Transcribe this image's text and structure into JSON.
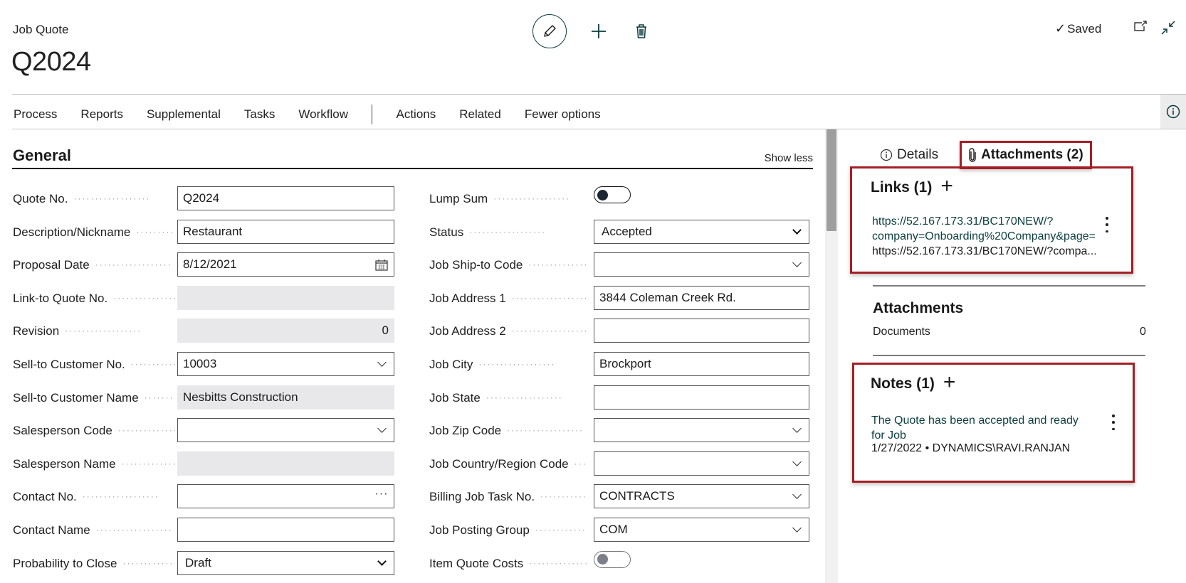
{
  "header": {
    "caption": "Job Quote",
    "title": "Q2024",
    "saved_label": "Saved",
    "icons": {
      "edit": "pencil-icon",
      "new": "plus-icon",
      "delete": "trash-icon",
      "open_new_window": "open-in-new-window-icon",
      "collapse": "collapse-icon"
    }
  },
  "action_bar": {
    "items": [
      "Process",
      "Reports",
      "Supplemental",
      "Tasks",
      "Workflow"
    ],
    "items_after_separator": [
      "Actions",
      "Related",
      "Fewer options"
    ],
    "info_icon": "info-icon"
  },
  "general": {
    "title": "General",
    "show_less": "Show less",
    "left_fields": [
      {
        "label": "Quote No.",
        "value": "Q2024",
        "type": "text"
      },
      {
        "label": "Description/Nickname",
        "value": "Restaurant",
        "type": "text"
      },
      {
        "label": "Proposal Date",
        "value": "8/12/2021",
        "type": "date"
      },
      {
        "label": "Link-to Quote No.",
        "value": "",
        "type": "readonly"
      },
      {
        "label": "Revision",
        "value": "0",
        "type": "readonly-number"
      },
      {
        "label": "Sell-to Customer No.",
        "value": "10003",
        "type": "lookup"
      },
      {
        "label": "Sell-to Customer Name",
        "value": "Nesbitts Construction",
        "type": "readonly"
      },
      {
        "label": "Salesperson Code",
        "value": "",
        "type": "lookup"
      },
      {
        "label": "Salesperson Name",
        "value": "",
        "type": "readonly"
      },
      {
        "label": "Contact No.",
        "value": "",
        "type": "assist"
      },
      {
        "label": "Contact Name",
        "value": "",
        "type": "text"
      },
      {
        "label": "Probability to Close",
        "value": "Draft",
        "type": "select"
      }
    ],
    "right_fields": [
      {
        "label": "Lump Sum",
        "value": "Off",
        "type": "toggle"
      },
      {
        "label": "Status",
        "value": "Accepted",
        "type": "select"
      },
      {
        "label": "Job Ship-to Code",
        "value": "",
        "type": "lookup"
      },
      {
        "label": "Job Address 1",
        "value": "3844 Coleman Creek Rd.",
        "type": "text"
      },
      {
        "label": "Job Address 2",
        "value": "",
        "type": "text"
      },
      {
        "label": "Job City",
        "value": "Brockport",
        "type": "text"
      },
      {
        "label": "Job State",
        "value": "",
        "type": "text"
      },
      {
        "label": "Job Zip Code",
        "value": "",
        "type": "lookup"
      },
      {
        "label": "Job Country/Region Code",
        "value": "",
        "type": "lookup"
      },
      {
        "label": "Billing Job Task No.",
        "value": "CONTRACTS",
        "type": "lookup"
      },
      {
        "label": "Job Posting Group",
        "value": "COM",
        "type": "lookup"
      },
      {
        "label": "Item Quote Costs",
        "value": "Off",
        "type": "toggle-disabled"
      }
    ]
  },
  "factbox": {
    "tabs": [
      {
        "label": "Details",
        "icon": "info-icon",
        "active": false
      },
      {
        "label": "Attachments (2)",
        "icon": "paperclip-icon",
        "active": true
      }
    ],
    "links": {
      "title": "Links (1)",
      "link_line1": "https://52.167.173.31/BC170NEW/?",
      "link_line2": "company=Onboarding%20Company&page=",
      "link_line3": "https://52.167.173.31/BC170NEW/?compa..."
    },
    "attachments": {
      "title": "Attachments",
      "documents_label": "Documents",
      "documents_count": "0"
    },
    "notes": {
      "title": "Notes (1)",
      "note_line1": "The Quote has been accepted and ready",
      "note_line2": "for Job",
      "meta": "1/27/2022 • DYNAMICS\\RAVI.RANJAN"
    },
    "highlight_color": "#a31f24"
  }
}
